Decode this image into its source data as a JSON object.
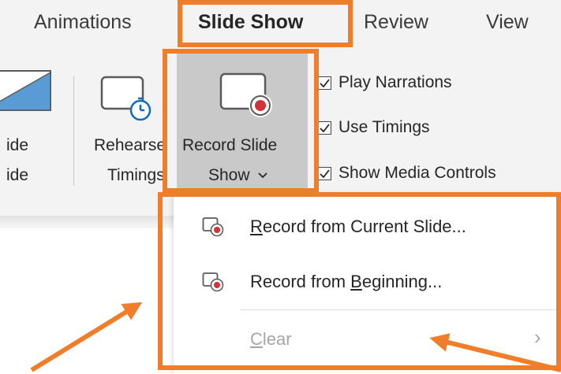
{
  "tabs": {
    "animations": "Animations",
    "slide_show": "Slide Show",
    "review": "Review",
    "view": "View"
  },
  "ribbon": {
    "partial_button_line1": "ide",
    "partial_button_line2": "ide",
    "rehearse_line1": "Rehearse",
    "rehearse_line2": "Timings",
    "record_line1": "Record Slide",
    "record_line2": "Show",
    "checkboxes": [
      {
        "label": "Play Narrations",
        "checked": true
      },
      {
        "label": "Use Timings",
        "checked": true
      },
      {
        "label": "Show Media Controls",
        "checked": true
      }
    ]
  },
  "menu": {
    "items": [
      {
        "pre": "",
        "acc": "R",
        "post": "ecord from Current Slide...",
        "enabled": true,
        "icon": "record-slide-icon"
      },
      {
        "pre": "Record from ",
        "acc": "B",
        "post": "eginning...",
        "enabled": true,
        "icon": "record-slide-icon"
      },
      {
        "pre": "",
        "acc": "C",
        "post": "lear",
        "enabled": false,
        "icon": "none"
      }
    ],
    "submenu_glyph": "›"
  },
  "colors": {
    "highlight": "#f07d2a",
    "ribbon_bg": "#f3f3f3",
    "record_red": "#d13438",
    "timer_blue": "#0f6cbd",
    "pressed_bg": "#c9c9c9"
  }
}
